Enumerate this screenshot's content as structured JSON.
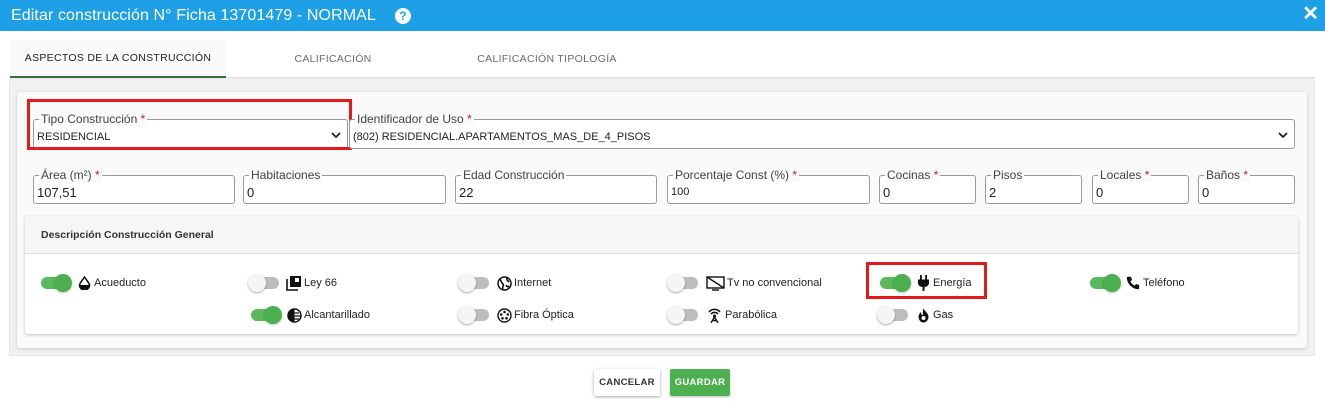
{
  "header": {
    "title": "Editar construcción N° Ficha 13701479 - NORMAL",
    "help_icon": "question-circle-icon",
    "close_icon": "close-icon"
  },
  "tabs": [
    {
      "label": "ASPECTOS DE LA CONSTRUCCIÓN",
      "active": true
    },
    {
      "label": "CALIFICACIÓN",
      "active": false
    },
    {
      "label": "CALIFICACIÓN TIPOLOGÍA",
      "active": false
    }
  ],
  "form": {
    "tipo_construccion": {
      "label": "Tipo Construcción",
      "required": "*",
      "value": "RESIDENCIAL"
    },
    "identificador_uso": {
      "label": "Identificador de Uso",
      "required": "*",
      "value": "(802) RESIDENCIAL.APARTAMENTOS_MAS_DE_4_PISOS"
    },
    "area": {
      "label": "Área (m²)",
      "required": "*",
      "value": "107,51"
    },
    "habitaciones": {
      "label": "Habitaciones",
      "required": "",
      "value": "0"
    },
    "edad": {
      "label": "Edad Construcción",
      "required": "",
      "value": "22"
    },
    "porcentaje": {
      "label": "Porcentaje Const (%)",
      "required": "*",
      "value": "100"
    },
    "cocinas": {
      "label": "Cocinas",
      "required": "*",
      "value": "0"
    },
    "pisos": {
      "label": "Pisos",
      "required": "",
      "value": "2"
    },
    "locales": {
      "label": "Locales",
      "required": "*",
      "value": "0"
    },
    "banos": {
      "label": "Baños",
      "required": "*",
      "value": "0"
    }
  },
  "descripcion": {
    "title": "Descripción Construcción General",
    "services": [
      {
        "label": "Acueducto",
        "on": true,
        "icon": "water-drop-icon"
      },
      {
        "label": "Ley 66",
        "on": false,
        "icon": "layers-icon"
      },
      {
        "label": "Internet",
        "on": false,
        "icon": "globe-icon"
      },
      {
        "label": "Tv no convencional",
        "on": false,
        "icon": "tv-off-icon"
      },
      {
        "label": "Energía",
        "on": true,
        "icon": "plug-icon"
      },
      {
        "label": "Teléfono",
        "on": true,
        "icon": "phone-icon"
      },
      {
        "label": "Alcantarillado",
        "on": true,
        "icon": "contrast-circle-icon"
      },
      {
        "label": "Fibra Óptica",
        "on": false,
        "icon": "fiber-icon"
      },
      {
        "label": "Parabólica",
        "on": false,
        "icon": "satellite-antenna-icon"
      },
      {
        "label": "Gas",
        "on": false,
        "icon": "flame-icon"
      }
    ]
  },
  "footer": {
    "cancel_label": "CANCELAR",
    "save_label": "GUARDAR"
  },
  "colors": {
    "header": "#1ea0e6",
    "highlight": "#e41a1a",
    "toggle_on": "#4caf50",
    "save_button": "#4caf50"
  }
}
